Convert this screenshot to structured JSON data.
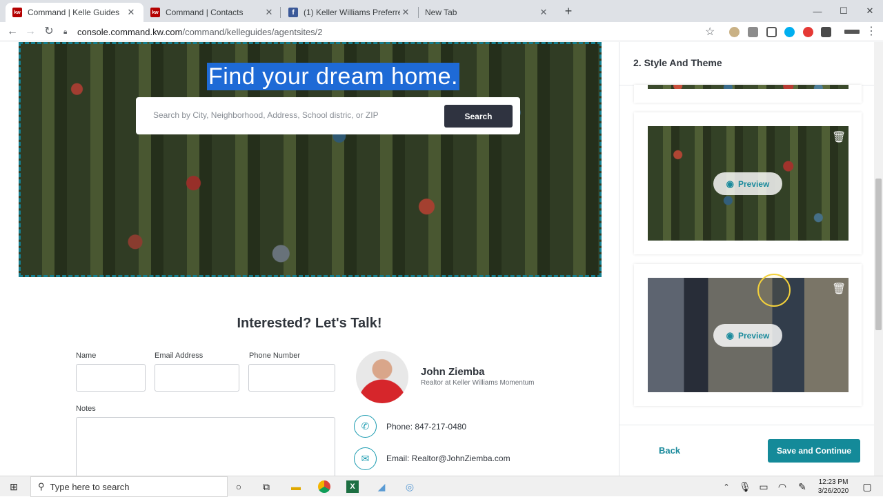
{
  "browser": {
    "tabs": [
      {
        "title": "Command | Kelle Guides",
        "favicon": "kw",
        "active": true
      },
      {
        "title": "Command | Contacts",
        "favicon": "kw",
        "active": false
      },
      {
        "title": "(1) Keller Williams Preferred Real",
        "favicon": "fb",
        "active": false
      },
      {
        "title": "New Tab",
        "favicon": "",
        "active": false
      }
    ],
    "fav_kw": "kw",
    "fav_fb": "f",
    "url_host": "console.command.kw.com",
    "url_path": "/command/kelleguides/agentsites/2"
  },
  "hero": {
    "title": "Find your dream home.",
    "search_placeholder": "Search by City, Neighborhood, Address, School distric, or ZIP",
    "search_button": "Search"
  },
  "contact": {
    "heading": "Interested? Let's Talk!",
    "labels": {
      "name": "Name",
      "email": "Email Address",
      "phone": "Phone Number",
      "notes": "Notes"
    },
    "agent_name": "John Ziemba",
    "agent_title": "Realtor at Keller Williams Momentum",
    "phone_line": "Phone: 847-217-0480",
    "email_line": "Email: Realtor@JohnZiemba.com"
  },
  "panel": {
    "title": "2. Style And Theme",
    "preview_label": "Preview",
    "back": "Back",
    "save": "Save and Continue"
  },
  "taskbar": {
    "search_placeholder": "Type here to search",
    "time": "12:23 PM",
    "date": "3/26/2020"
  },
  "colors": {
    "accent": "#148a99",
    "selection": "#1e6ad6",
    "kw_red": "#b40101"
  }
}
